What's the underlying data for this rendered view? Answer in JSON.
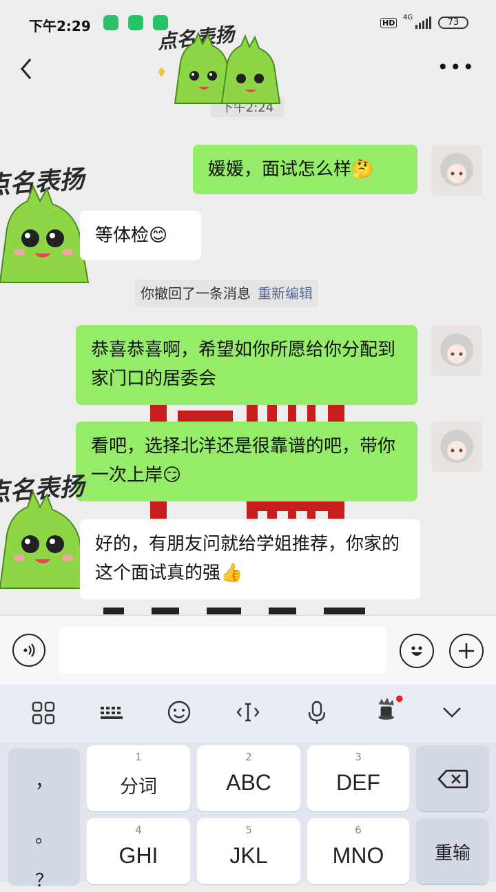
{
  "status_bar": {
    "time": "下午2:29",
    "hd": "HD",
    "network": "4G",
    "battery": "73"
  },
  "chat": {
    "timestamp": "下午2:24",
    "sticker_caption": "点名表扬",
    "messages": [
      {
        "side": "sent",
        "text": "媛媛，面试怎么样"
      },
      {
        "side": "received",
        "text": "等体检"
      },
      {
        "side": "sent",
        "text": "恭喜恭喜啊，希望如你所愿给你分配到家门口的居委会"
      },
      {
        "side": "sent",
        "text": "看吧，选择北洋还是很靠谱的吧，带你一次上岸"
      },
      {
        "side": "received",
        "text": "好的，有朋友问就给学姐推荐，你家的这个面试真的强"
      }
    ],
    "recall_notice": {
      "text": "你撤回了一条消息",
      "action": "重新编辑"
    }
  },
  "input": {
    "value": ""
  },
  "keyboard": {
    "punctuation": [
      "，",
      "。",
      "？"
    ],
    "keys": [
      {
        "num": "1",
        "label": "分词"
      },
      {
        "num": "2",
        "label": "ABC"
      },
      {
        "num": "3",
        "label": "DEF"
      },
      {
        "num": "4",
        "label": "GHI"
      },
      {
        "num": "5",
        "label": "JKL"
      },
      {
        "num": "6",
        "label": "MNO"
      }
    ],
    "reenter": "重输"
  },
  "colors": {
    "sent_bubble": "#95ec69",
    "received_bubble": "#ffffff",
    "chat_background": "#ededed",
    "link": "#576b95",
    "sticker_green": "#8ed646"
  }
}
